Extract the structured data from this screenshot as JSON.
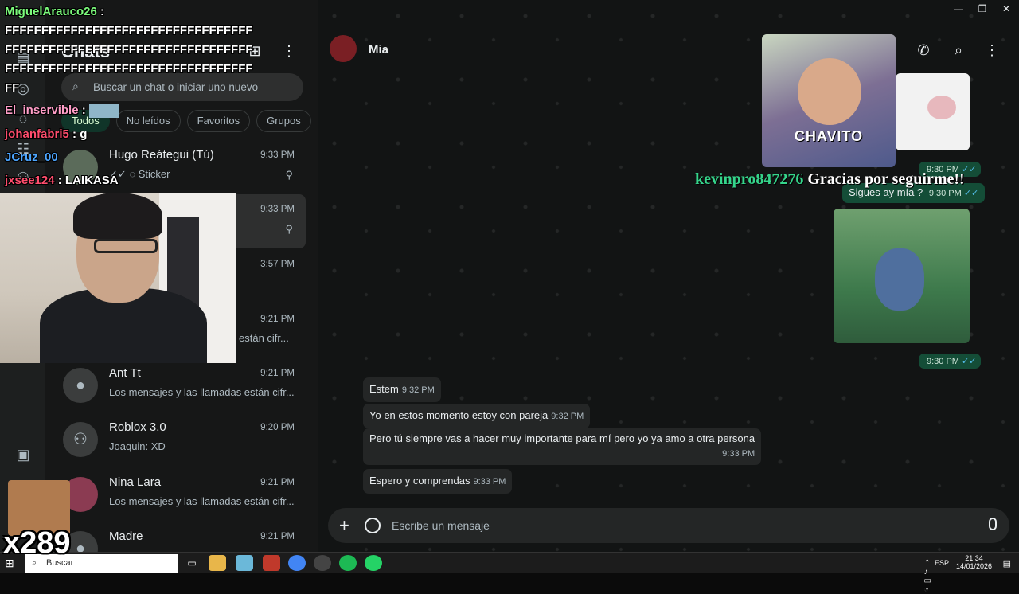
{
  "window": {
    "minimize": "—",
    "maximize": "❐",
    "close": "✕"
  },
  "rail": {
    "icons": [
      "chats-icon",
      "status-icon",
      "channels-icon",
      "communities-icon",
      "media-icon"
    ]
  },
  "sidebar": {
    "title": "Chats",
    "new_chat": "⊞",
    "menu": "⋮",
    "search_placeholder": "Buscar un chat o iniciar uno nuevo",
    "filters": [
      "Todos",
      "No leídos",
      "Favoritos",
      "Grupos"
    ],
    "chats": [
      {
        "name": "Hugo Reátegui (Tú)",
        "time": "9:33 PM",
        "preview": "✓✓ ◌ Sticker",
        "pinned": true
      },
      {
        "name": "",
        "time": "9:33 PM",
        "preview": "",
        "pinned": true
      },
      {
        "name": "",
        "time": "3:57 PM",
        "preview": ""
      },
      {
        "name": "",
        "time": "9:21 PM",
        "preview": "están cifr..."
      },
      {
        "name": "Ant Tt",
        "time": "9:21 PM",
        "preview": "Los mensajes y las llamadas están cifr..."
      },
      {
        "name": "Roblox 3.0",
        "time": "9:20 PM",
        "preview": "Joaquin: XD"
      },
      {
        "name": "Nina Lara",
        "time": "9:21 PM",
        "preview": "Los mensajes y las llamadas están cifr..."
      },
      {
        "name": "Madre",
        "time": "9:21 PM",
        "preview": ""
      }
    ]
  },
  "conversation": {
    "contact": "Mia",
    "sticker_label": "CHAVITO",
    "outgoing": [
      {
        "text": "",
        "time": "9:30 PM"
      },
      {
        "text": "Sigues ay mía ?",
        "time": "9:30 PM"
      },
      {
        "text": "",
        "time": "9:30 PM"
      }
    ],
    "incoming": [
      {
        "text": "Estem",
        "time": "9:32 PM"
      },
      {
        "text": "Yo en estos momento estoy con pareja",
        "time": "9:32 PM"
      },
      {
        "text": "Pero tú siempre vas a hacer muy importante para mí pero yo ya amo a otra persona",
        "time": "9:33 PM"
      },
      {
        "text": "Espero y  comprendas",
        "time": "9:33 PM"
      }
    ],
    "composer_placeholder": "Escribe un mensaje"
  },
  "stream_overlay": {
    "chat": [
      {
        "user": "MiguelArauco26",
        "text": "",
        "color": "#7CFC7C"
      },
      {
        "user": "",
        "text": "FFFFFFFFFFFFFFFFFFFFFFFFFFFFFFFFFF",
        "color": "#ffffff"
      },
      {
        "user": "",
        "text": "FFFFFFFFFFFFFFFFFFFFFFFFFFFFFFFFFF",
        "color": "#ffffff"
      },
      {
        "user": "",
        "text": "FFFFFFFFFFFFFFFFFFFFFFFFFFFFFFFFFF",
        "color": "#ffffff"
      },
      {
        "user": "",
        "text": "FF",
        "color": "#ffffff"
      },
      {
        "user": "El_inservible",
        "text": "",
        "color": "#ff9ec8"
      },
      {
        "user": "johanfabri5",
        "text": "g",
        "color": "#ff4d6d"
      },
      {
        "user": "JCruz_00",
        "text": "",
        "color": "#4da6ff"
      },
      {
        "user": "jxsee124",
        "text": "LAIKASA",
        "color": "#ff4d6d"
      }
    ],
    "follow_user": "kevinpro847276",
    "follow_text": "Gracias por seguirme!!",
    "counter": "x289"
  },
  "taskbar": {
    "search": "Buscar",
    "lang": "ESP",
    "time": "21:34",
    "date": "14/01/2026"
  },
  "colors": {
    "accent": "#00a884",
    "outgoing_bubble": "#144d37",
    "incoming_bubble": "#242626",
    "read_ticks": "#53bdeb"
  }
}
